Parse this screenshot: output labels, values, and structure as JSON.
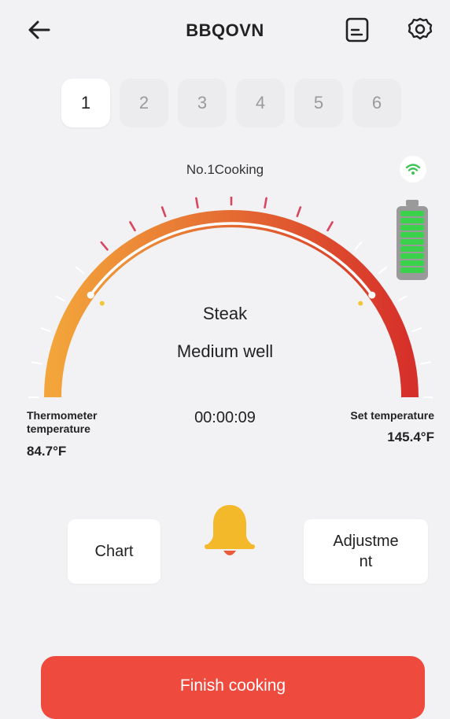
{
  "header": {
    "title": "BBQOVN",
    "back_icon": "arrow-left-icon",
    "report_icon": "document-icon",
    "settings_icon": "gear-icon"
  },
  "probes": {
    "tabs": [
      "1",
      "2",
      "3",
      "4",
      "5",
      "6"
    ],
    "active_index": 0
  },
  "status": {
    "label": "No.1Cooking",
    "wifi_icon": "wifi-icon",
    "battery_icon": "battery-icon",
    "battery_level": 1.0
  },
  "gauge": {
    "food": "Steak",
    "doneness": "Medium well",
    "thermometer_label": "Thermometer temperature",
    "thermometer_value": "84.7°F",
    "timer": "00:00:09",
    "set_label": "Set temperature",
    "set_value": "145.4°F",
    "colors": {
      "start": "#f3a53b",
      "end": "#d6302a",
      "tick": "#d9465f",
      "marker": "#f4c534"
    }
  },
  "actions": {
    "chart_label": "Chart",
    "adjustment_label": "Adjustme nt",
    "bell_icon": "bell-icon",
    "bell_color": "#f3b92b",
    "finish_label": "Finish cooking",
    "finish_color": "#ee4a3d"
  }
}
